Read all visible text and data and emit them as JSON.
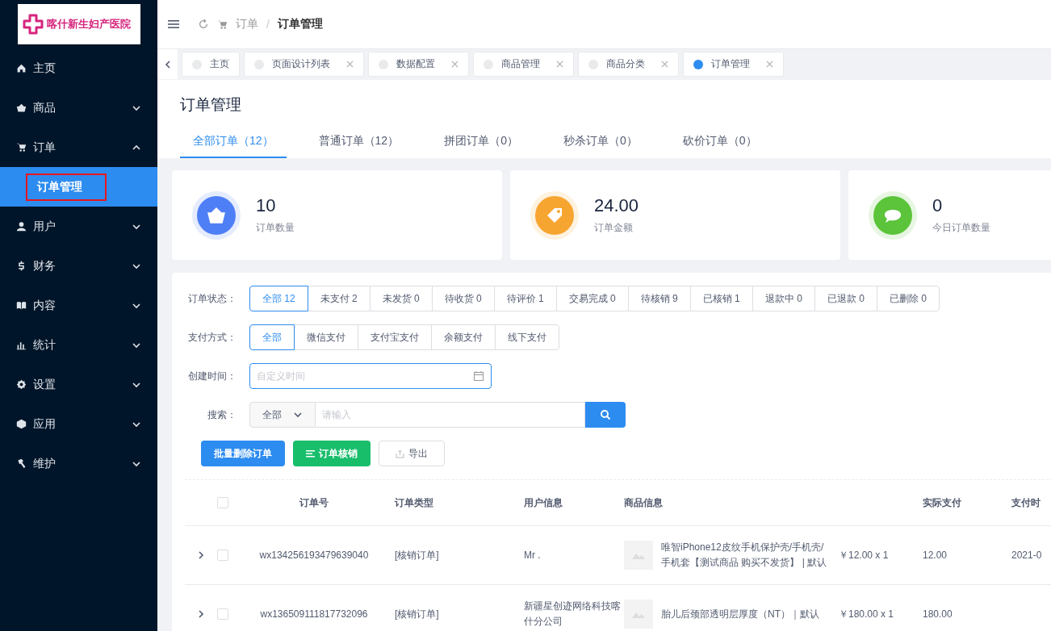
{
  "logo": {
    "text": "喀什新生妇产医院"
  },
  "sidebar": {
    "items": [
      {
        "label": "主页",
        "selected": false
      },
      {
        "label": "商品",
        "expanded": false,
        "selected": false
      },
      {
        "label": "订单",
        "expanded": true,
        "selected": false,
        "children": [
          {
            "label": "订单管理",
            "selected": true,
            "highlighted": true
          }
        ]
      },
      {
        "label": "用户",
        "expanded": false,
        "selected": false
      },
      {
        "label": "财务",
        "expanded": false,
        "selected": false
      },
      {
        "label": "内容",
        "expanded": false,
        "selected": false
      },
      {
        "label": "统计",
        "expanded": false,
        "selected": false
      },
      {
        "label": "设置",
        "expanded": false,
        "selected": false
      },
      {
        "label": "应用",
        "expanded": false,
        "selected": false
      },
      {
        "label": "维护",
        "expanded": false,
        "selected": false
      }
    ]
  },
  "breadcrumb": [
    "订单",
    "订单管理"
  ],
  "breadcrumb_separator": "/",
  "tabs": [
    {
      "label": "主页",
      "selected": false,
      "closable": false
    },
    {
      "label": "页面设计列表",
      "selected": false,
      "closable": true
    },
    {
      "label": "数据配置",
      "selected": false,
      "closable": true
    },
    {
      "label": "商品管理",
      "selected": false,
      "closable": true
    },
    {
      "label": "商品分类",
      "selected": false,
      "closable": true
    },
    {
      "label": "订单管理",
      "selected": true,
      "closable": true
    }
  ],
  "page_title": "订单管理",
  "order_tabs": [
    {
      "label": "全部订单（12）",
      "selected": true
    },
    {
      "label": "普通订单（12）",
      "selected": false
    },
    {
      "label": "拼团订单（0）",
      "selected": false
    },
    {
      "label": "秒杀订单（0）",
      "selected": false
    },
    {
      "label": "砍价订单（0）",
      "selected": false
    }
  ],
  "stats": [
    {
      "value": "10",
      "label": "订单数量",
      "color": "#4f7ff7"
    },
    {
      "value": "24.00",
      "label": "订单金额",
      "color": "#f7a531"
    },
    {
      "value": "0",
      "label": "今日订单数量",
      "color": "#5bc43a"
    }
  ],
  "filters": {
    "status": {
      "label": "订单状态：",
      "options": [
        {
          "label": "全部 12",
          "selected": true
        },
        {
          "label": "未支付 2",
          "selected": false
        },
        {
          "label": "未发货 0",
          "selected": false
        },
        {
          "label": "待收货 0",
          "selected": false
        },
        {
          "label": "待评价 1",
          "selected": false
        },
        {
          "label": "交易完成 0",
          "selected": false
        },
        {
          "label": "待核销 9",
          "selected": false
        },
        {
          "label": "已核销 1",
          "selected": false
        },
        {
          "label": "退款中 0",
          "selected": false
        },
        {
          "label": "已退款 0",
          "selected": false
        },
        {
          "label": "已删除 0",
          "selected": false
        }
      ]
    },
    "payment": {
      "label": "支付方式：",
      "options": [
        {
          "label": "全部",
          "selected": true
        },
        {
          "label": "微信支付",
          "selected": false
        },
        {
          "label": "支付宝支付",
          "selected": false
        },
        {
          "label": "余额支付",
          "selected": false
        },
        {
          "label": "线下支付",
          "selected": false
        }
      ]
    },
    "created": {
      "label": "创建时间：",
      "placeholder": "自定义时间"
    },
    "search": {
      "label": "搜索：",
      "scope": "全部",
      "placeholder": "请输入"
    }
  },
  "actions": [
    {
      "label": "批量删除订单",
      "kind": "primary"
    },
    {
      "label": "订单核销",
      "kind": "success"
    },
    {
      "label": "导出",
      "kind": "plain"
    }
  ],
  "table": {
    "all_checked": false,
    "columns": [
      "订单号",
      "订单类型",
      "用户信息",
      "商品信息",
      "实际支付",
      "支付时"
    ],
    "rows": [
      {
        "checked": false,
        "order_no": "wx134256193479639040",
        "type": "[核销订单]",
        "user": "Mr .",
        "product": "唯智iPhone12皮纹手机保护壳/手机壳/手机套【测试商品 购买不发货】 |  默认",
        "price_qty": "￥12.00 x 1",
        "paid": "12.00",
        "paid_time": "2021-0"
      },
      {
        "checked": false,
        "order_no": "wx136509111817732096",
        "type": "[核销订单]",
        "user": "新疆星创迹网络科技喀什分公司",
        "product": "胎儿后颈部透明层厚度（NT）｜默认",
        "price_qty": "￥180.00 x 1",
        "paid": "180.00"
      }
    ]
  }
}
